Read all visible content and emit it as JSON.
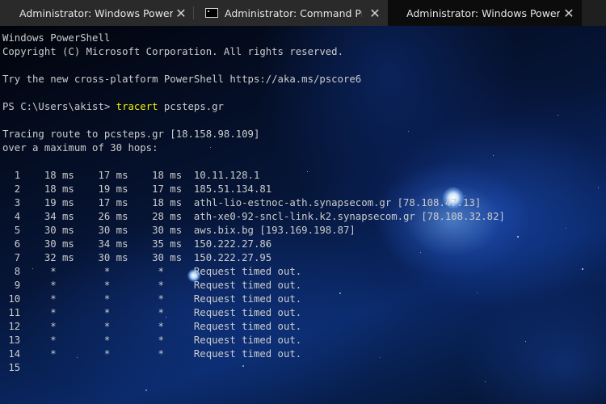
{
  "tabs": [
    {
      "title": "Administrator: Windows PowerShe",
      "close": "✕",
      "icon": "powershell-icon",
      "state": "inactive"
    },
    {
      "title": "Administrator: Command Promp",
      "close": "✕",
      "icon": "cmd-icon",
      "state": "inactive"
    },
    {
      "title": "Administrator: Windows PowerShe",
      "close": "✕",
      "icon": "powershell-icon",
      "state": "active"
    }
  ],
  "terminal": {
    "header": [
      "Windows PowerShell",
      "Copyright (C) Microsoft Corporation. All rights reserved.",
      "",
      "Try the new cross-platform PowerShell https://aka.ms/pscore6",
      ""
    ],
    "prompt": {
      "path": "PS C:\\Users\\akist> ",
      "command": "tracert",
      "argument": " pcsteps.gr"
    },
    "trace_header": [
      "",
      "Tracing route to pcsteps.gr [18.158.98.109]",
      "over a maximum of 30 hops:",
      ""
    ],
    "hops": [
      "  1    18 ms    17 ms    18 ms  10.11.128.1",
      "  2    18 ms    19 ms    17 ms  185.51.134.81",
      "  3    19 ms    17 ms    18 ms  athl-lio-estnoc-ath.synapsecom.gr [78.108.47.13]",
      "  4    34 ms    26 ms    28 ms  ath-xe0-92-sncl-link.k2.synapsecom.gr [78.108.32.82]",
      "  5    30 ms    30 ms    30 ms  aws.bix.bg [193.169.198.87]",
      "  6    30 ms    34 ms    35 ms  150.222.27.86",
      "  7    32 ms    30 ms    30 ms  150.222.27.95",
      "  8     *        *        *     Request timed out.",
      "  9     *        *        *     Request timed out.",
      " 10     *        *        *     Request timed out.",
      " 11     *        *        *     Request timed out.",
      " 12     *        *        *     Request timed out.",
      " 13     *        *        *     Request timed out.",
      " 14     *        *        *     Request timed out.",
      " 15"
    ]
  },
  "colors": {
    "command": "#f2f200",
    "text": "#cccccc",
    "tab_bar": "#1f1f1f",
    "active_tab": "#0c0c0c"
  }
}
